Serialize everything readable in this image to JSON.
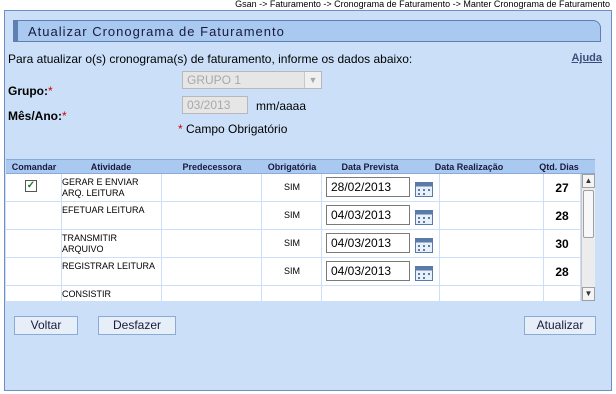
{
  "breadcrumb": "Gsan -> Faturamento -> Cronograma de Faturamento -> Manter Cronograma de Faturamento",
  "page_title": "Atualizar Cronograma de Faturamento",
  "intro_text": "Para atualizar o(s) cronograma(s) de faturamento, informe os dados abaixo:",
  "help_link": "Ajuda",
  "form": {
    "grupo_label": "Grupo:",
    "grupo_required": "*",
    "grupo_value": "GRUPO 1",
    "mesano_label": "Mês/Ano:",
    "mesano_required": "*",
    "mesano_value": "03/2013",
    "mesano_unit": "mm/aaaa",
    "required_star": "*",
    "required_note": " Campo Obrigatório"
  },
  "table": {
    "headers": [
      "Comandar",
      "Atividade",
      "Predecessora",
      "Obrigatória",
      "Data Prevista",
      "Data Realização",
      "Qtd. Dias"
    ],
    "rows": [
      {
        "checked": true,
        "atividade": "GERAR E ENVIAR ARQ. LEITURA",
        "predecessora": "",
        "obrigatoria": "SIM",
        "data_prevista": "28/02/2013",
        "data_realizacao": "",
        "qtd_dias": "27"
      },
      {
        "checked": false,
        "atividade": "EFETUAR LEITURA",
        "predecessora": "",
        "obrigatoria": "SIM",
        "data_prevista": "04/03/2013",
        "data_realizacao": "",
        "qtd_dias": "28"
      },
      {
        "checked": false,
        "atividade": "TRANSMITIR ARQUIVO",
        "predecessora": "",
        "obrigatoria": "SIM",
        "data_prevista": "04/03/2013",
        "data_realizacao": "",
        "qtd_dias": "30"
      },
      {
        "checked": false,
        "atividade": "REGISTRAR LEITURA",
        "predecessora": "",
        "obrigatoria": "SIM",
        "data_prevista": "04/03/2013",
        "data_realizacao": "",
        "qtd_dias": "28"
      },
      {
        "checked": false,
        "atividade": "CONSISTIR",
        "predecessora": "",
        "obrigatoria": "",
        "data_prevista": "",
        "data_realizacao": "",
        "qtd_dias": ""
      }
    ]
  },
  "buttons": {
    "voltar": "Voltar",
    "desfazer": "Desfazer",
    "atualizar": "Atualizar"
  },
  "icons": {
    "checkmark": "✓",
    "calendar": "calendar-icon",
    "dropdown": "chevron-down-icon",
    "scroll_up": "▲",
    "scroll_down": "▼"
  },
  "colors": {
    "panel_bg": "#cbe0f8",
    "title_bar_bg": "#a9c9f0",
    "required_red": "#d00000",
    "check_green": "#1f7a1f"
  }
}
